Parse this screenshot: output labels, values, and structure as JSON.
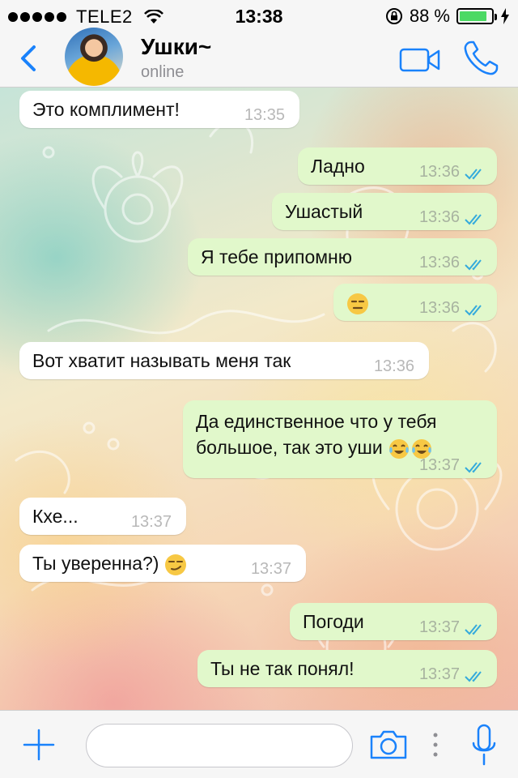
{
  "status_bar": {
    "carrier": "TELE2",
    "time": "13:38",
    "battery_percent": "88 %",
    "battery_level": 0.88,
    "signal_bars": 5
  },
  "header": {
    "back_icon": "chevron-left-icon",
    "contact_name": "Ушки~",
    "contact_status": "online",
    "video_icon": "video-camera-icon",
    "call_icon": "phone-icon",
    "accent_color": "#1a82fb"
  },
  "messages": [
    {
      "direction": "in",
      "text": "Это комплимент!",
      "time": "13:35"
    },
    {
      "direction": "out",
      "text": "Ладно",
      "time": "13:36",
      "read": true
    },
    {
      "direction": "out",
      "text": "Ушастый",
      "time": "13:36",
      "read": true
    },
    {
      "direction": "out",
      "text": "Я тебе припомню",
      "time": "13:36",
      "read": true
    },
    {
      "direction": "out",
      "emoji": "expressionless-face",
      "time": "13:36",
      "read": true
    },
    {
      "direction": "in",
      "text": "Вот хватит называть меня так",
      "time": "13:36"
    },
    {
      "direction": "out",
      "text": "Да единственное что у тебя большое, так это уши",
      "emoji": "tears-of-joy x2",
      "time": "13:37",
      "read": true
    },
    {
      "direction": "in",
      "text": "Кхе...",
      "time": "13:37"
    },
    {
      "direction": "in",
      "text": "Ты уверенна?)",
      "emoji": "smirking-face",
      "time": "13:37"
    },
    {
      "direction": "out",
      "text": "Погоди",
      "time": "13:37",
      "read": true
    },
    {
      "direction": "out",
      "text": "Ты не так понял!",
      "time": "13:37",
      "read": true
    }
  ],
  "colors": {
    "outgoing_bubble": "#e1f8cb",
    "incoming_bubble": "#ffffff",
    "read_ticks": "#34aadc"
  },
  "input_bar": {
    "plus_icon": "plus-icon",
    "message_placeholder": "",
    "camera_icon": "camera-icon",
    "mic_icon": "microphone-icon"
  }
}
